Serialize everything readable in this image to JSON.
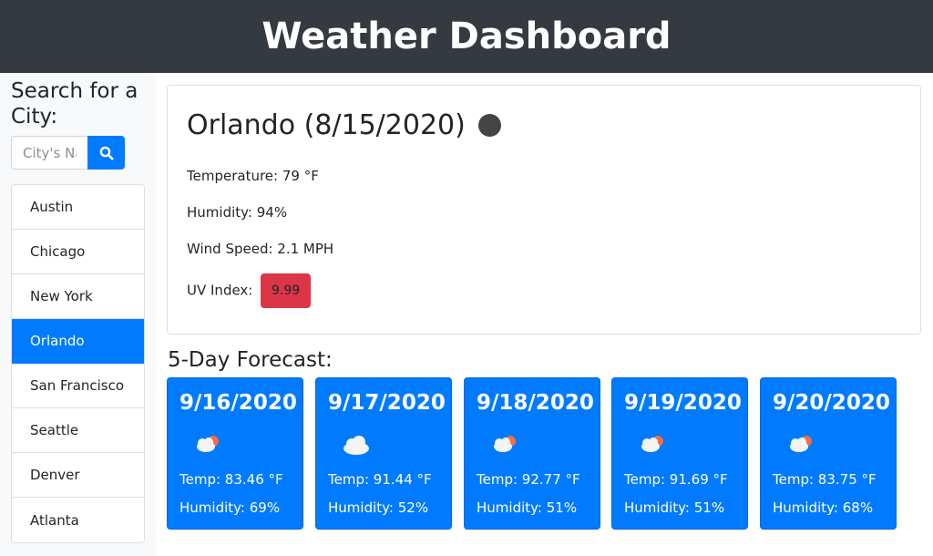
{
  "header": {
    "title": "Weather Dashboard"
  },
  "sidebar": {
    "title": "Search for a City:",
    "search": {
      "placeholder": "City's Name",
      "value": "",
      "button_icon": "search-icon"
    },
    "cities": [
      {
        "label": "Austin",
        "active": false
      },
      {
        "label": "Chicago",
        "active": false
      },
      {
        "label": "New York",
        "active": false
      },
      {
        "label": "Orlando",
        "active": true
      },
      {
        "label": "San Francisco",
        "active": false
      },
      {
        "label": "Seattle",
        "active": false
      },
      {
        "label": "Denver",
        "active": false
      },
      {
        "label": "Atlanta",
        "active": false
      }
    ]
  },
  "current": {
    "title": "Orlando (8/15/2020)",
    "icon": "dark-circle-icon",
    "temperature": "Temperature: 79 °F",
    "humidity": "Humidity: 94%",
    "wind": "Wind Speed: 2.1 MPH",
    "uv_label": "UV Index:",
    "uv_value": "9.99",
    "uv_color": "#dc3545"
  },
  "forecast": {
    "title": "5-Day Forecast:",
    "days": [
      {
        "date": "9/16/2020",
        "icon": "rain-cloud-sun-icon",
        "temp": "Temp: 83.46 °F",
        "humidity": "Humidity: 69%"
      },
      {
        "date": "9/17/2020",
        "icon": "cloud-icon",
        "temp": "Temp: 91.44 °F",
        "humidity": "Humidity: 52%"
      },
      {
        "date": "9/18/2020",
        "icon": "rain-cloud-sun-icon",
        "temp": "Temp: 92.77 °F",
        "humidity": "Humidity: 51%"
      },
      {
        "date": "9/19/2020",
        "icon": "rain-cloud-sun-icon",
        "temp": "Temp: 91.69 °F",
        "humidity": "Humidity: 51%"
      },
      {
        "date": "9/20/2020",
        "icon": "rain-cloud-sun-icon",
        "temp": "Temp: 83.75 °F",
        "humidity": "Humidity: 68%"
      }
    ]
  },
  "colors": {
    "header_bg": "#343a40",
    "accent": "#007bff",
    "uv_danger": "#dc3545"
  }
}
